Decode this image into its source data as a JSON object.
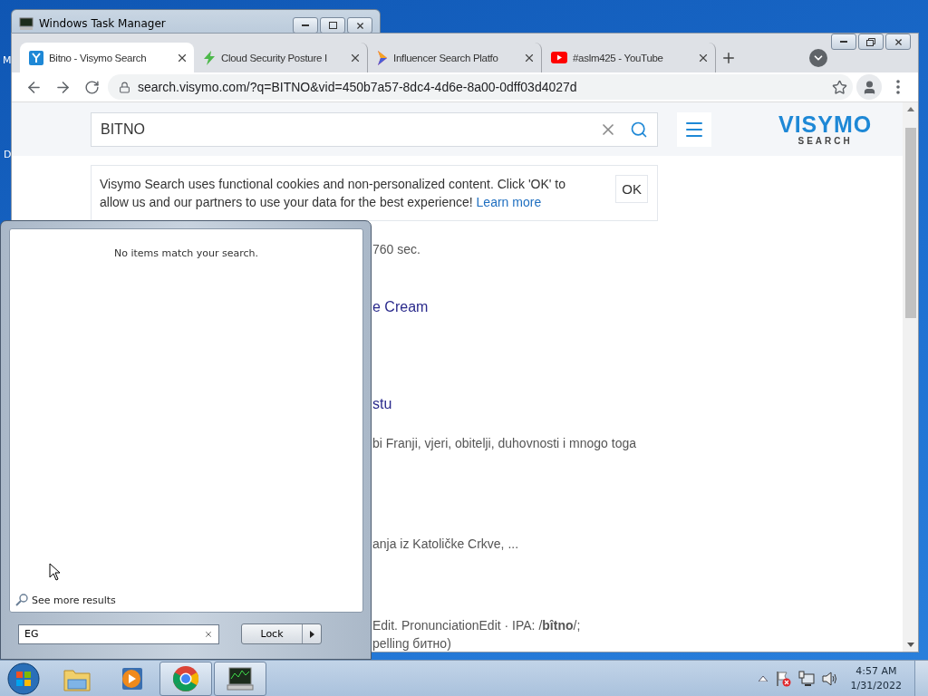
{
  "desktop": {
    "icon_labels": [
      "M",
      "D"
    ]
  },
  "background_window": {
    "title": "Windows Task Manager"
  },
  "browser": {
    "tabs": [
      {
        "kind": "visymo",
        "label": "Bitno - Visymo Search",
        "selected": true
      },
      {
        "kind": "bolt",
        "label": "Cloud Security Posture I",
        "selected": false
      },
      {
        "kind": "influencer",
        "label": "Influencer Search Platfo",
        "selected": false
      },
      {
        "kind": "youtube",
        "label": "#aslm425 - YouTube",
        "selected": false
      }
    ],
    "address": "search.visymo.com/?q=BITNO&vid=450b7a57-8dc4-4d6e-8a00-0dff03d4027d",
    "search": {
      "value": "BITNO"
    },
    "logo": {
      "name": "VISYMO",
      "sub": "SEARCH"
    },
    "cookie_notice": {
      "text": "Visymo Search uses functional cookies and non-personalized content. Click 'OK' to allow us and our partners to use your data for the best experience!",
      "link": "Learn more",
      "button": "OK"
    },
    "results": [
      {
        "kind": "meta",
        "text": "760 sec."
      },
      {
        "kind": "title",
        "text": "e Cream"
      },
      {
        "kind": "title",
        "text": "stu"
      },
      {
        "kind": "snippet",
        "text": "bi Franji, vjeri, obitelji, duhovnosti i mnogo toga"
      },
      {
        "kind": "snippet",
        "text": "anja iz Katoličke Crkve, ..."
      },
      {
        "kind": "snippet",
        "text": "Edit. PronunciationEdit · IPA: /**bîtno**/;"
      },
      {
        "kind": "snippet",
        "text": "pelling битно)"
      }
    ]
  },
  "start_menu": {
    "message": "No items match your search.",
    "more_link": "See more results",
    "search": {
      "value": "EG"
    },
    "power_button": "Lock"
  },
  "taskbar": {
    "apps": [
      {
        "kind": "explorer",
        "active": false
      },
      {
        "kind": "media",
        "active": false
      },
      {
        "kind": "chrome",
        "active": true
      },
      {
        "kind": "monitor",
        "active": true
      }
    ],
    "clock": {
      "time": "4:57 AM",
      "date": "1/31/2022"
    }
  }
}
